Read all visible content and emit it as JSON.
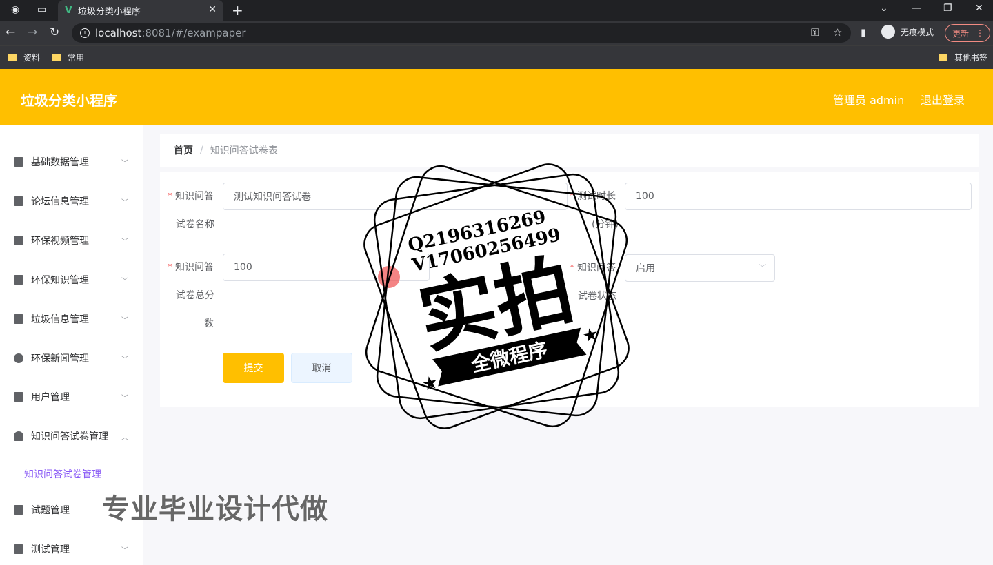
{
  "browser": {
    "tab_title": "垃圾分类小程序",
    "url_host": "localhost",
    "url_rest": ":8081/#/exampaper",
    "incognito_label": "无痕模式",
    "update_label": "更新",
    "bookmarks": [
      "资料",
      "常用"
    ],
    "other_bookmarks": "其他书签"
  },
  "header": {
    "brand": "垃圾分类小程序",
    "user": "管理员 admin",
    "logout": "退出登录"
  },
  "sidebar": {
    "items": [
      {
        "label": "基础数据管理",
        "expanded": false
      },
      {
        "label": "论坛信息管理",
        "expanded": false
      },
      {
        "label": "环保视频管理",
        "expanded": false
      },
      {
        "label": "环保知识管理",
        "expanded": false
      },
      {
        "label": "垃圾信息管理",
        "expanded": false
      },
      {
        "label": "环保新闻管理",
        "expanded": false
      },
      {
        "label": "用户管理",
        "expanded": false
      },
      {
        "label": "知识问答试卷管理",
        "expanded": true
      },
      {
        "label": "试题管理",
        "expanded": false
      },
      {
        "label": "测试管理",
        "expanded": false
      }
    ],
    "active_sub": "知识问答试卷管理"
  },
  "breadcrumb": {
    "home": "首页",
    "current": "知识问答试卷表"
  },
  "form": {
    "name_label_1": "知识问答",
    "name_label_2": "试卷名称",
    "name_value": "测试知识问答试卷",
    "duration_label_1": "测试时长",
    "duration_label_2": "(分钟)",
    "duration_value": "100",
    "score_label_1": "知识问答",
    "score_label_2": "试卷总分",
    "score_label_3": "数",
    "score_value": "100",
    "status_label_1": "知识问答",
    "status_label_2": "试卷状态",
    "status_value": "启用",
    "submit": "提交",
    "cancel": "取消"
  },
  "watermark": {
    "qq": "Q2196316269",
    "v": "V17060256499",
    "main": "实拍",
    "ribbon": "全微程序",
    "bottom": "专业毕业设计代做"
  },
  "colors": {
    "accent": "#ffbf00",
    "active_sub": "#8b5cf6"
  }
}
